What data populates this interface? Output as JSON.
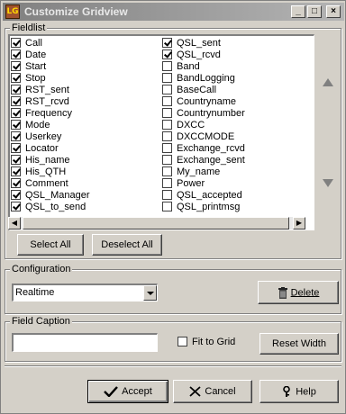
{
  "window": {
    "title": "Customize Gridview",
    "app_icon_text": "LG",
    "minimize_glyph": "_",
    "maximize_glyph": "□",
    "close_glyph": "×"
  },
  "fieldlist": {
    "label": "Fieldlist",
    "column1": [
      {
        "label": "Call",
        "checked": true
      },
      {
        "label": "Date",
        "checked": true
      },
      {
        "label": "Start",
        "checked": true
      },
      {
        "label": "Stop",
        "checked": true
      },
      {
        "label": "RST_sent",
        "checked": true
      },
      {
        "label": "RST_rcvd",
        "checked": true
      },
      {
        "label": "Frequency",
        "checked": true
      },
      {
        "label": "Mode",
        "checked": true
      },
      {
        "label": "Userkey",
        "checked": true
      },
      {
        "label": "Locator",
        "checked": true
      },
      {
        "label": "His_name",
        "checked": true
      },
      {
        "label": "His_QTH",
        "checked": true
      },
      {
        "label": "Comment",
        "checked": true
      },
      {
        "label": "QSL_Manager",
        "checked": true
      },
      {
        "label": "QSL_to_send",
        "checked": true
      }
    ],
    "column2": [
      {
        "label": "QSL_sent",
        "checked": true
      },
      {
        "label": "QSL_rcvd",
        "checked": true
      },
      {
        "label": "Band",
        "checked": false
      },
      {
        "label": "BandLogging",
        "checked": false
      },
      {
        "label": "BaseCall",
        "checked": false
      },
      {
        "label": "Countryname",
        "checked": false
      },
      {
        "label": "Countrynumber",
        "checked": false
      },
      {
        "label": "DXCC",
        "checked": false
      },
      {
        "label": "DXCCMODE",
        "checked": false
      },
      {
        "label": "Exchange_rcvd",
        "checked": false
      },
      {
        "label": "Exchange_sent",
        "checked": false
      },
      {
        "label": "My_name",
        "checked": false
      },
      {
        "label": "Power",
        "checked": false
      },
      {
        "label": "QSL_accepted",
        "checked": false
      },
      {
        "label": "QSL_printmsg",
        "checked": false
      }
    ],
    "select_all_label": "Select All",
    "deselect_all_label": "Deselect All"
  },
  "configuration": {
    "label": "Configuration",
    "selected": "Realtime",
    "delete_label": "Delete"
  },
  "field_caption": {
    "label": "Field Caption",
    "value": "",
    "fit_to_grid_label": "Fit to Grid",
    "fit_to_grid_checked": false,
    "reset_width_label": "Reset Width"
  },
  "footer": {
    "accept_label": "Accept",
    "cancel_label": "Cancel",
    "help_label": "Help"
  }
}
